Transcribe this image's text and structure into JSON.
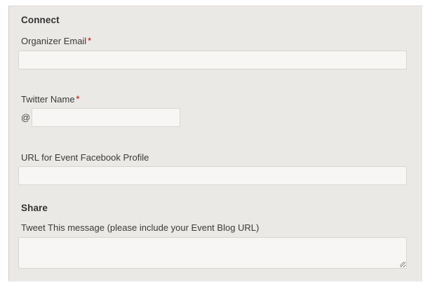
{
  "connect": {
    "title": "Connect",
    "organizer_email": {
      "label": "Organizer Email",
      "required_mark": "*",
      "value": "",
      "placeholder": ""
    },
    "twitter_name": {
      "label": "Twitter Name",
      "required_mark": "*",
      "prefix": "@",
      "value": "",
      "placeholder": ""
    },
    "facebook_url": {
      "label": "URL for Event Facebook Profile",
      "value": "",
      "placeholder": ""
    }
  },
  "share": {
    "title": "Share",
    "tweet_message": {
      "label": "Tweet This message (please include your Event Blog URL)",
      "value": "",
      "placeholder": ""
    }
  },
  "colors": {
    "panel_bg": "#ebe9e6",
    "input_bg": "#f7f6f4",
    "required": "#c43b2c"
  }
}
